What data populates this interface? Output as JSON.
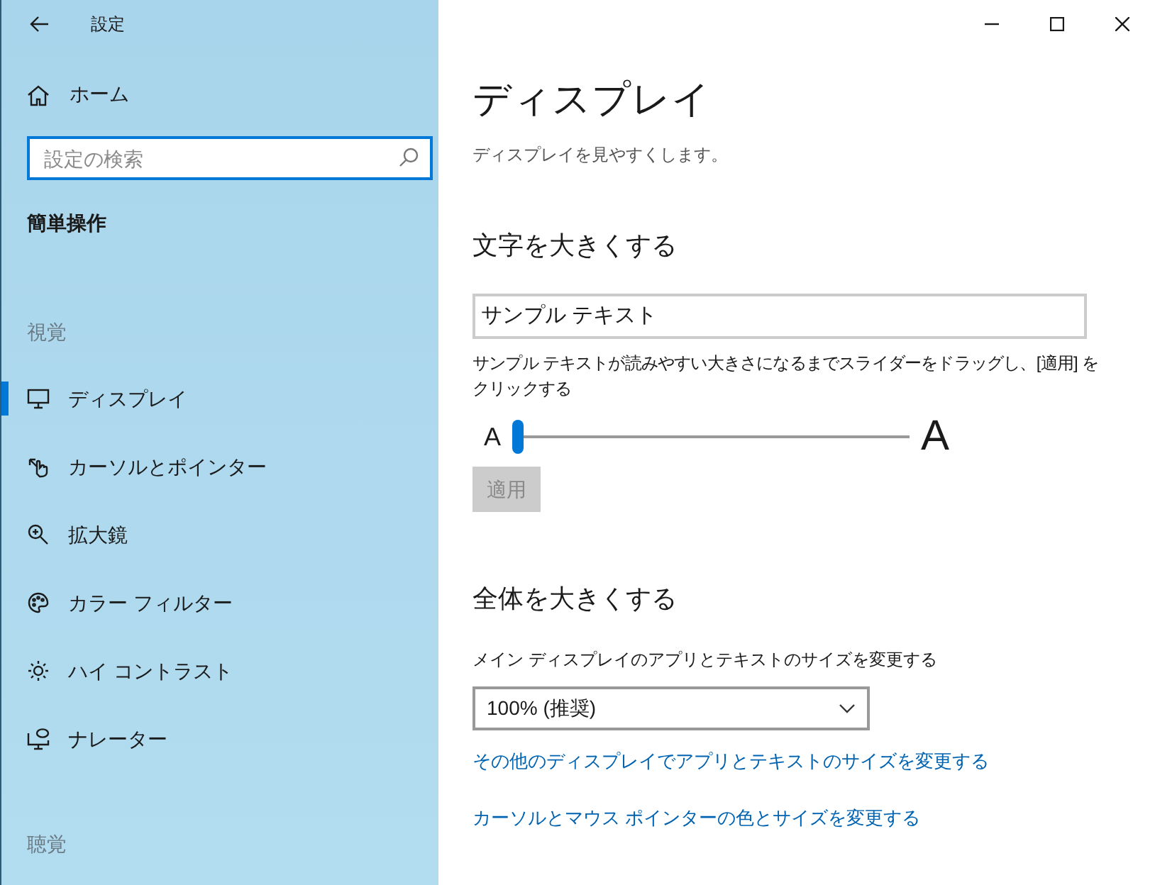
{
  "window": {
    "title": "設定",
    "controls": [
      {
        "kind": "minimize"
      },
      {
        "kind": "maximize"
      },
      {
        "kind": "close"
      }
    ]
  },
  "sidebar": {
    "home": "ホーム",
    "search": {
      "placeholder": "設定の検索"
    },
    "category": "簡単操作",
    "groups": [
      {
        "heading": "視覚",
        "items": [
          {
            "label": "ディスプレイ",
            "kind": "monitor",
            "selected": true
          },
          {
            "label": "カーソルとポインター",
            "kind": "pointer",
            "selected": false
          },
          {
            "label": "拡大鏡",
            "kind": "magnifier",
            "selected": false
          },
          {
            "label": "カラー フィルター",
            "kind": "palette",
            "selected": false
          },
          {
            "label": "ハイ コントラスト",
            "kind": "sun",
            "selected": false
          },
          {
            "label": "ナレーター",
            "kind": "narrator",
            "selected": false
          }
        ]
      },
      {
        "heading": "聴覚"
      }
    ]
  },
  "page": {
    "title": "ディスプレイ",
    "subtitle": "ディスプレイを見やすくします。",
    "sections": [
      {
        "heading": "文字を大きくする",
        "sample": "サンプル テキスト",
        "description": "サンプル テキストが読みやすい大きさになるまでスライダーをドラッグし、[適用] をクリックする",
        "slider": {
          "min_label": "A",
          "max_label": "A",
          "level": 0
        },
        "apply": {
          "label": "適用",
          "disabled": true
        }
      },
      {
        "heading": "全体を大きくする",
        "dropdown_label": "メイン ディスプレイのアプリとテキストのサイズを変更する",
        "dropdown_value": "100% (推奨)",
        "links": [
          "その他のディスプレイでアプリとテキストのサイズを変更する",
          "カーソルとマウス ポインターの色とサイズを変更する"
        ]
      }
    ]
  }
}
